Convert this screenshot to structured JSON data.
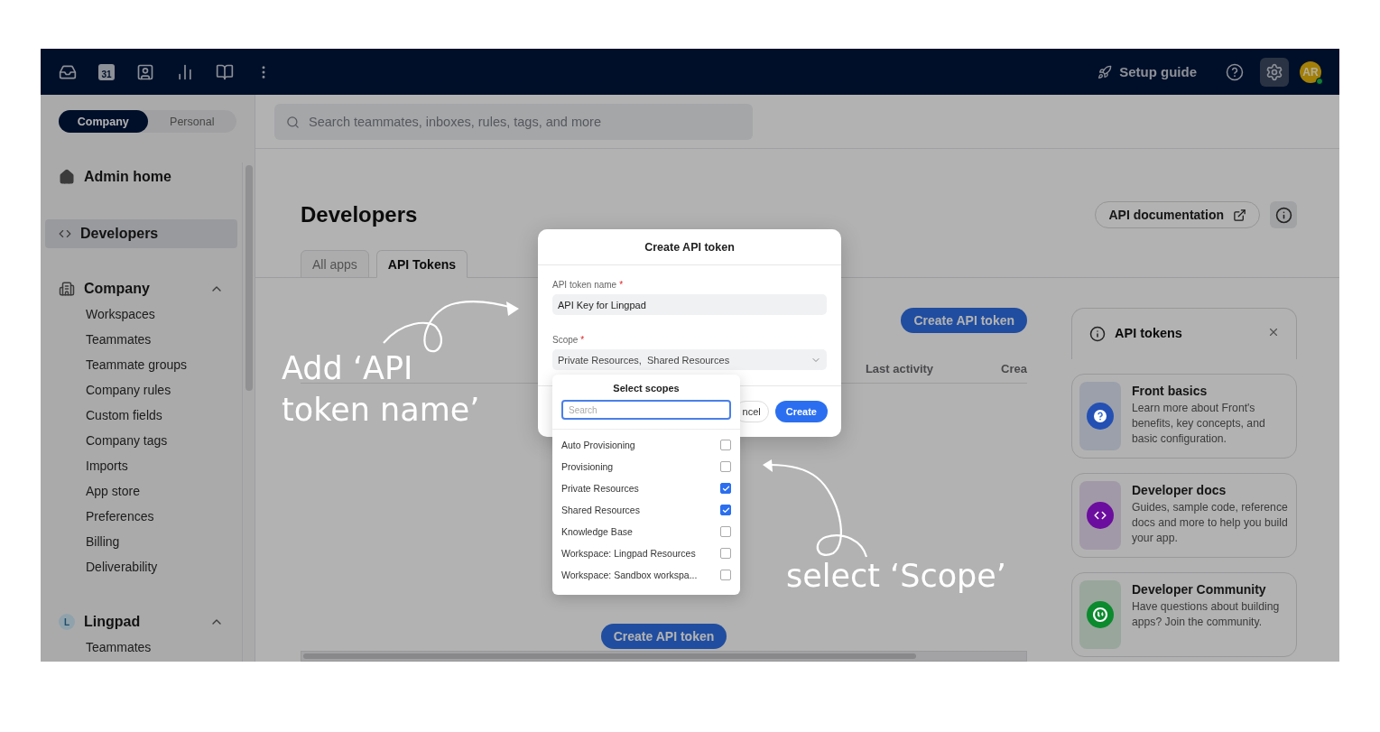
{
  "topbar": {
    "calendar_day": "31",
    "setup_guide": "Setup guide",
    "settings_selected": true,
    "avatar": {
      "initials": "AR",
      "online": true
    }
  },
  "sidebar": {
    "toggle": [
      {
        "label": "Company",
        "selected": true
      },
      {
        "label": "Personal",
        "selected": false
      }
    ],
    "items": [
      {
        "kind": "home",
        "label": "Admin home",
        "selected": false
      },
      {
        "kind": "code",
        "label": "Developers",
        "selected": true
      }
    ],
    "sections": [
      {
        "kind": "building",
        "title": "Company",
        "expanded": true,
        "children": [
          "Workspaces",
          "Teammates",
          "Teammate groups",
          "Company rules",
          "Custom fields",
          "Company tags",
          "Imports",
          "App store",
          "Preferences",
          "Billing",
          "Deliverability"
        ]
      },
      {
        "kind": "letter",
        "badge": "L",
        "title": "Lingpad",
        "expanded": true,
        "children": [
          "Teammates"
        ]
      }
    ]
  },
  "search": {
    "placeholder": "Search teammates, inboxes, rules, tags, and more"
  },
  "page": {
    "title": "Developers",
    "doc_button": "API documentation",
    "tabs": [
      {
        "label": "All apps",
        "selected": false
      },
      {
        "label": "API Tokens",
        "selected": true
      }
    ],
    "create_button": "Create API token",
    "columns": [
      "Last activity",
      "Crea"
    ],
    "empty_button": "Create API token"
  },
  "info_card": {
    "title": "API tokens"
  },
  "resource_cards": [
    {
      "kind": "help",
      "title": "Front basics",
      "description": "Learn more about Front's benefits, key concepts, and basic configuration.",
      "color": "#2450b4"
    },
    {
      "kind": "code",
      "title": "Developer docs",
      "description": "Guides, sample code, reference docs and more to help you build your app.",
      "color": "#6b0d9e"
    },
    {
      "kind": "community",
      "title": "Developer Community",
      "description": "Have questions about building apps? Join the community.",
      "color": "#0b8a2e"
    }
  ],
  "modal": {
    "title": "Create API token",
    "name_field": {
      "label": "API token name",
      "required_mark": "*",
      "value": "API Key for Lingpad"
    },
    "scope_field": {
      "label": "Scope",
      "required_mark": "*",
      "value": "Private Resources,  Shared Resources"
    },
    "cancel_button": "ncel",
    "create_button": "Create"
  },
  "scope_dropdown": {
    "title": "Select scopes",
    "search_placeholder": "Search",
    "options": [
      {
        "label": "Auto Provisioning",
        "checked": false
      },
      {
        "label": "Provisioning",
        "checked": false
      },
      {
        "label": "Private Resources",
        "checked": true
      },
      {
        "label": "Shared Resources",
        "checked": true
      },
      {
        "label": "Knowledge Base",
        "checked": false
      },
      {
        "label": "Workspace: Lingpad Resources",
        "checked": false
      },
      {
        "label": "Workspace: Sandbox workspa...",
        "checked": false
      }
    ]
  },
  "annotations": [
    {
      "lines": [
        "Add ‘API",
        "token name’"
      ]
    },
    {
      "lines": [
        "select ‘Scope’"
      ]
    }
  ]
}
